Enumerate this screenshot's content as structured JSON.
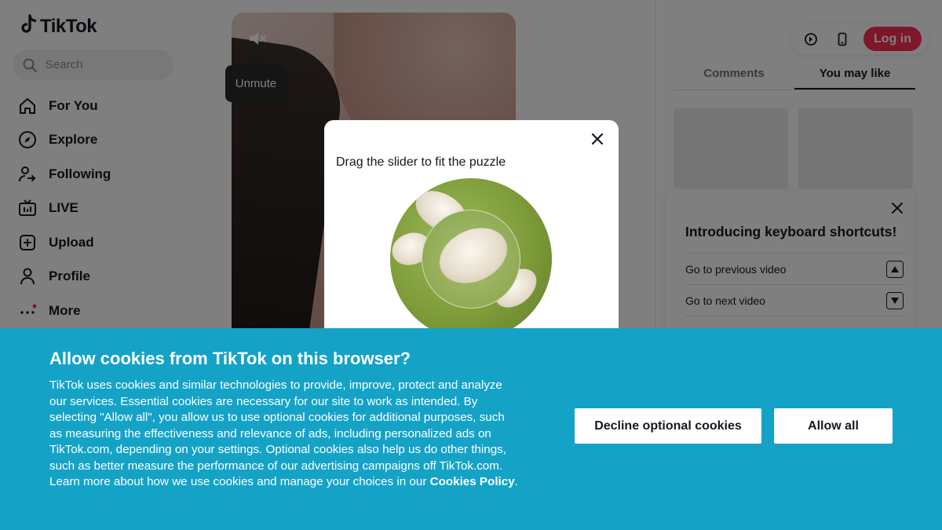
{
  "app": {
    "logo_text": "TikTok"
  },
  "search": {
    "placeholder": "Search"
  },
  "nav": {
    "items": [
      {
        "label": "For You",
        "icon": "home-icon"
      },
      {
        "label": "Explore",
        "icon": "compass-icon"
      },
      {
        "label": "Following",
        "icon": "following-icon"
      },
      {
        "label": "LIVE",
        "icon": "live-icon"
      },
      {
        "label": "Upload",
        "icon": "upload-icon"
      },
      {
        "label": "Profile",
        "icon": "profile-icon"
      },
      {
        "label": "More",
        "icon": "more-icon"
      }
    ]
  },
  "video": {
    "mute_tooltip": "Unmute"
  },
  "header": {
    "login_label": "Log in"
  },
  "tabs": [
    {
      "label": "Comments"
    },
    {
      "label": "You may like",
      "active": true
    }
  ],
  "shortcuts": {
    "title": "Introducing keyboard shortcuts!",
    "rows": [
      {
        "label": "Go to previous video",
        "key_icon": "arrow-up-icon"
      },
      {
        "label": "Go to next video",
        "key_icon": "arrow-down-icon"
      }
    ]
  },
  "captcha": {
    "instruction": "Drag the slider to fit the puzzle"
  },
  "cookie": {
    "title": "Allow cookies from TikTok on this browser?",
    "body": "TikTok uses cookies and similar technologies to provide, improve, protect and analyze our services. Essential cookies are necessary for our site to work as intended. By selecting \"Allow all\", you allow us to use optional cookies for additional purposes, such as measuring the effectiveness and relevance of ads, including personalized ads on TikTok.com, depending on your settings. Optional cookies also help us do other things, such as better measure the performance of our advertising campaigns off TikTok.com. Learn more about how we use cookies and manage your choices in our ",
    "policy_link": "Cookies Policy",
    "policy_end": ".",
    "decline_label": "Decline optional cookies",
    "allow_label": "Allow all"
  },
  "colors": {
    "brand": "#fe2c55",
    "banner": "#14a3c7",
    "text": "#161823"
  }
}
